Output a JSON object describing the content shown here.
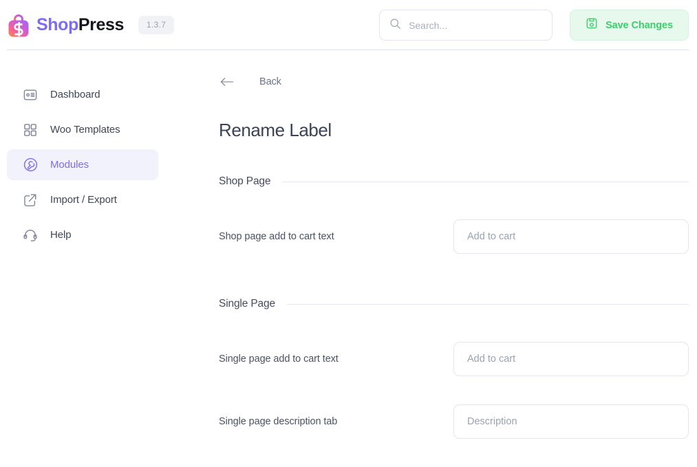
{
  "header": {
    "brand": {
      "logo_icon": "shopping-bag-logo-icon",
      "name_primary": "Shop",
      "name_secondary": "Press"
    },
    "version": "1.3.7",
    "search": {
      "icon": "search-icon",
      "value": "",
      "placeholder": "Search..."
    },
    "save_button": {
      "icon": "save-disk-icon",
      "label": "Save Changes",
      "bg_color": "#e6f9ec",
      "text_color": "#3ecf6d"
    }
  },
  "sidebar": {
    "items": [
      {
        "label": "Dashboard",
        "icon": "id-card-icon",
        "active": false
      },
      {
        "label": "Woo Templates",
        "icon": "grid-squares-icon",
        "active": false
      },
      {
        "label": "Modules",
        "icon": "wrench-circle-icon",
        "active": true
      },
      {
        "label": "Import / Export",
        "icon": "export-box-arrow-icon",
        "active": false
      },
      {
        "label": "Help",
        "icon": "headset-icon",
        "active": false
      }
    ],
    "active_color": "#7d6cf5",
    "active_bg": "#f2f2fd"
  },
  "main": {
    "back": {
      "icon": "arrow-left-icon",
      "label": "Back"
    },
    "title": "Rename Label",
    "sections": [
      {
        "title": "Shop Page",
        "fields": [
          {
            "label": "Shop page add to cart text",
            "value": "",
            "placeholder": "Add to cart"
          }
        ]
      },
      {
        "title": "Single Page",
        "fields": [
          {
            "label": "Single page add to cart text",
            "value": "",
            "placeholder": "Add to cart"
          },
          {
            "label": "Single page description tab",
            "value": "",
            "placeholder": "Description"
          }
        ]
      }
    ]
  }
}
